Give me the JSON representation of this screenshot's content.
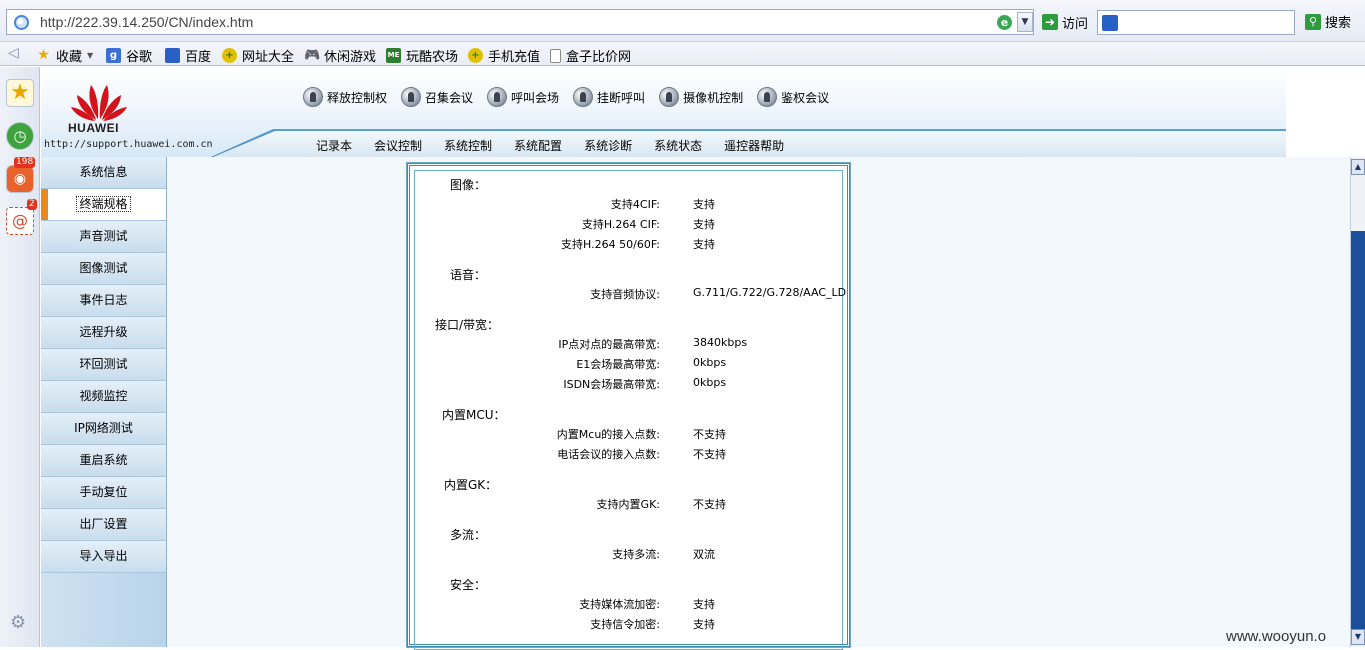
{
  "browser": {
    "url": "http://222.39.14.250/CN/index.htm",
    "go_label": "访问",
    "search_label": "搜索",
    "favorites": [
      {
        "label": "收藏",
        "icon": "star-icon",
        "color": "#e8a800"
      },
      {
        "label": "谷歌",
        "icon": "google-icon",
        "color": "#3b6fd6"
      },
      {
        "label": "百度",
        "icon": "baidu-paw-icon",
        "color": "#2c5fc5"
      },
      {
        "label": "网址大全",
        "icon": "site-nav-icon",
        "color": "#3c9a2f"
      },
      {
        "label": "休闲游戏",
        "icon": "gamepad-icon",
        "color": "#6b6b6b"
      },
      {
        "label": "玩酷农场",
        "icon": "farm-icon",
        "color": "#2f7d2f"
      },
      {
        "label": "手机充值",
        "icon": "phone-charge-icon",
        "color": "#3c9a2f"
      },
      {
        "label": "盒子比价网",
        "icon": "page-icon",
        "color": "#8a8a8a"
      }
    ],
    "side_badges": {
      "weibo": "198",
      "mail": "2"
    }
  },
  "header": {
    "logo_text": "HUAWEI",
    "support_url": "http://support.huawei.com.cn",
    "toolbar": [
      "释放控制权",
      "召集会议",
      "呼叫会场",
      "挂断呼叫",
      "摄像机控制",
      "鉴权会议"
    ],
    "menu": [
      "记录本",
      "会议控制",
      "系统控制",
      "系统配置",
      "系统诊断",
      "系统状态",
      "遥控器帮助"
    ]
  },
  "leftnav": {
    "items": [
      "系统信息",
      "终端规格",
      "声音测试",
      "图像测试",
      "事件日志",
      "远程升级",
      "环回测试",
      "视频监控",
      "IP网络测试",
      "重启系统",
      "手动复位",
      "出厂设置",
      "导入导出"
    ],
    "active_index": 1
  },
  "spec": {
    "sections": [
      {
        "title": "图像：",
        "rows": [
          {
            "label": "支持4CIF:",
            "value": "支持"
          },
          {
            "label": "支持H.264 CIF:",
            "value": "支持"
          },
          {
            "label": "支持H.264 50/60F:",
            "value": "支持"
          }
        ]
      },
      {
        "title": "语音：",
        "rows": [
          {
            "label": "支持音频协议:",
            "value": "G.711/G.722/G.728/AAC_LD"
          }
        ]
      },
      {
        "title": "接口/带宽：",
        "rows": [
          {
            "label": "IP点对点的最高带宽:",
            "value": "3840kbps"
          },
          {
            "label": "E1会场最高带宽:",
            "value": "0kbps"
          },
          {
            "label": "ISDN会场最高带宽:",
            "value": "0kbps"
          }
        ]
      },
      {
        "title": "内置MCU：",
        "rows": [
          {
            "label": "内置Mcu的接入点数:",
            "value": "不支持"
          },
          {
            "label": "电话会议的接入点数:",
            "value": "不支持"
          }
        ]
      },
      {
        "title": "内置GK：",
        "rows": [
          {
            "label": "支持内置GK:",
            "value": "不支持"
          }
        ]
      },
      {
        "title": "多流：",
        "rows": [
          {
            "label": "支持多流:",
            "value": "双流"
          }
        ]
      },
      {
        "title": "安全：",
        "rows": [
          {
            "label": "支持媒体流加密:",
            "value": "支持"
          },
          {
            "label": "支持信令加密:",
            "value": "支持"
          }
        ]
      }
    ]
  },
  "watermark": "www.wooyun.o"
}
